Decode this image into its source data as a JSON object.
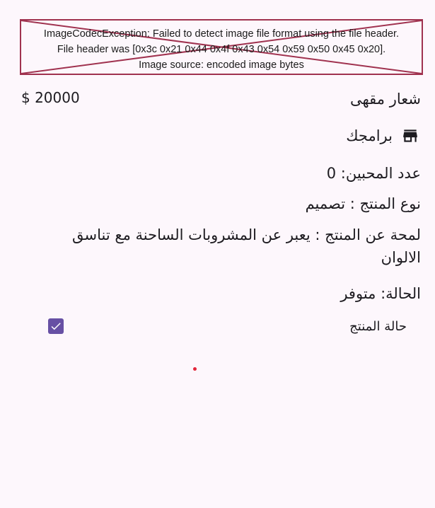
{
  "image_error": {
    "line1": "ImageCodecException: Failed to detect image file format using the file header.",
    "line2": "File header was [0x3c 0x21 0x44 0x4f 0x43 0x54 0x59 0x50 0x45 0x20].",
    "line3": "Image source: encoded image bytes",
    "border_color": "#a0324f"
  },
  "product": {
    "title": "شعار مقهى",
    "price": "$ 20000",
    "store_name": "برامجك",
    "store_icon": "store-icon",
    "fans_count": "عدد المحبين: 0",
    "product_type": "نوع المنتج : تصميم",
    "description": "لمحة عن المنتج : يعبر عن المشروبات الساحنة مع تناسق الالوان",
    "status": "الحالة: متوفر"
  },
  "product_state": {
    "label": "حالة المنتج",
    "checked": true,
    "accent": "#6750a4"
  },
  "colors": {
    "background": "#fdf7fc",
    "text": "#1d1b20",
    "dot": "#e3263b"
  }
}
